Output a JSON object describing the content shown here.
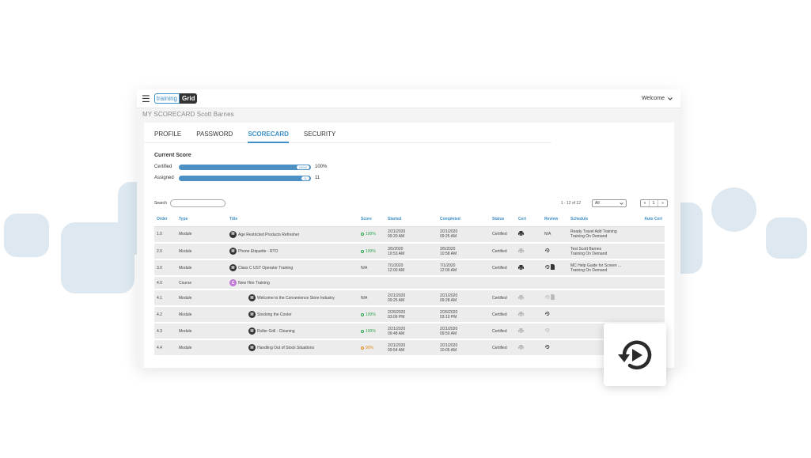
{
  "app": {
    "logo_left": "training",
    "logo_right": "Grid",
    "welcome": "Welcome",
    "page_heading": "MY SCORECARD Scott Barnes"
  },
  "tabs": [
    "PROFILE",
    "PASSWORD",
    "SCORECARD",
    "SECURITY"
  ],
  "active_tab": "SCORECARD",
  "score": {
    "title": "Current Score",
    "certified_label": "Certified",
    "certified_bar_text": "100%",
    "certified_value": "100%",
    "certified_fraction": 1.0,
    "assigned_label": "Assigned",
    "assigned_bar_text": "11",
    "assigned_value": "11",
    "assigned_fraction": 1.0
  },
  "toolbar": {
    "search_label": "Search",
    "page_count": "1 - 12 of 12",
    "filter_value": "All",
    "pager_prev": "«",
    "pager_page": "1",
    "pager_next": "»"
  },
  "table": {
    "headers": [
      "Order",
      "Type",
      "Title",
      "Score",
      "Started",
      "Completed",
      "Status",
      "Cert",
      "Review",
      "Schedule",
      "Auto Cert"
    ],
    "rows": [
      {
        "order": "1.0",
        "type": "Module",
        "badge": "M",
        "title": "Age Restricted Products Refresher",
        "score": "100%",
        "score_kind": "good",
        "started1": "2/21/2020",
        "started2": "09:20 AM",
        "completed1": "2/21/2020",
        "completed2": "09:25 AM",
        "status": "Certified",
        "review": "N/A",
        "schedule1": "Ready Travel Add Training",
        "schedule2": "Training On Demand"
      },
      {
        "order": "2.0",
        "type": "Module",
        "badge": "M",
        "title": "Phone Etiquette - RTO",
        "score": "100%",
        "score_kind": "good",
        "started1": "3/5/2020",
        "started2": "10:53 AM",
        "completed1": "3/5/2020",
        "completed2": "10:58 AM",
        "status": "Certified",
        "review": "",
        "schedule1": "Test Scott Barnes",
        "schedule2": "Training On Demand"
      },
      {
        "order": "3.0",
        "type": "Module",
        "badge": "M",
        "title": "Class C UST Operator Training",
        "score": "N/A",
        "score_kind": "na",
        "started1": "7/1/2020",
        "started2": "12:00 AM",
        "completed1": "7/1/2020",
        "completed2": "12:00 AM",
        "status": "Certified",
        "review": "",
        "schedule1": "MC Help Guide for Screen ...",
        "schedule2": "Training On Demand"
      },
      {
        "order": "4.0",
        "type": "Course",
        "badge": "C",
        "title": "New Hire Training",
        "score": "",
        "score_kind": "",
        "started1": "",
        "started2": "",
        "completed1": "",
        "completed2": "",
        "status": "",
        "review": "",
        "schedule1": "",
        "schedule2": ""
      },
      {
        "order": "4.1",
        "type": "Module",
        "badge": "M",
        "title": "Welcome to the Convenience Store Industry",
        "score": "N/A",
        "score_kind": "na",
        "started1": "2/21/2020",
        "started2": "09:25 AM",
        "completed1": "2/21/2020",
        "completed2": "09:28 AM",
        "status": "Certified",
        "review": "",
        "schedule1": "",
        "schedule2": ""
      },
      {
        "order": "4.2",
        "type": "Module",
        "badge": "M",
        "title": "Stocking the Cooler",
        "score": "100%",
        "score_kind": "good",
        "started1": "2/26/2020",
        "started2": "03:09 PM",
        "completed1": "2/26/2020",
        "completed2": "03:10 PM",
        "status": "Certified",
        "review": "",
        "schedule1": "",
        "schedule2": ""
      },
      {
        "order": "4.3",
        "type": "Module",
        "badge": "M",
        "title": "Roller Grill - Cleaning",
        "score": "100%",
        "score_kind": "good",
        "started1": "2/21/2020",
        "started2": "09:48 AM",
        "completed1": "2/21/2020",
        "completed2": "09:50 AM",
        "status": "Certified",
        "review": "",
        "schedule1": "",
        "schedule2": ""
      },
      {
        "order": "4.4",
        "type": "Module",
        "badge": "M",
        "title": "Handling Out of Stock Situations",
        "score": "90%",
        "score_kind": "warn",
        "started1": "2/21/2020",
        "started2": "09:54 AM",
        "completed1": "2/21/2020",
        "completed2": "10:05 AM",
        "status": "Certified",
        "review": "",
        "schedule1": "",
        "schedule2": ""
      }
    ]
  },
  "icons": {
    "cert": "printer-icon",
    "review": "replay-icon",
    "doc": "document-icon",
    "callout": "replay-play-icon"
  },
  "colors": {
    "accent": "#3d8fc7",
    "bar": "#4d90c4",
    "good": "#2aa44a",
    "warn": "#e48a1c",
    "course_badge": "#c07ad6"
  }
}
